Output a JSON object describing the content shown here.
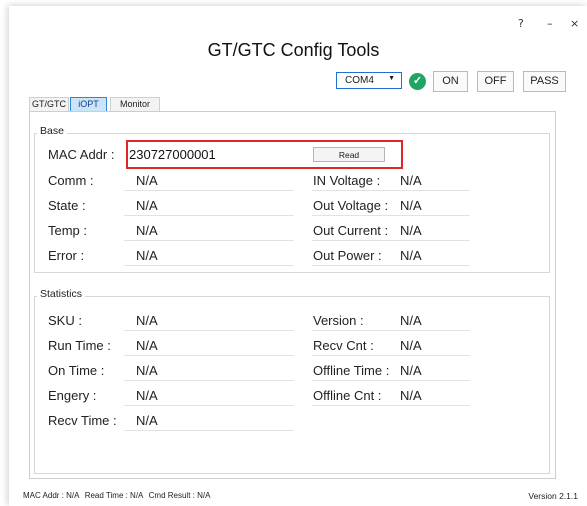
{
  "window": {
    "title": "GT/GTC Config Tools",
    "help_label": "?",
    "minimize_label": "–",
    "close_label": "×"
  },
  "toolbar": {
    "port_value": "COM4",
    "port_caret": "▼",
    "status_icon": "check-circle-icon",
    "status_glyph": "✓",
    "status_color": "#1fa664",
    "on_label": "ON",
    "off_label": "OFF",
    "pass_label": "PASS"
  },
  "tabs": [
    {
      "label": "GT/GTC",
      "active": false
    },
    {
      "label": "iOPT",
      "active": true
    },
    {
      "label": "Monitor",
      "active": false
    }
  ],
  "base": {
    "title": "Base",
    "mac_label": "MAC Addr :",
    "mac_value": "230727000001",
    "read_label": "Read",
    "highlight_color": "#e0262a",
    "left": [
      {
        "label": "Comm :",
        "value": "N/A"
      },
      {
        "label": "State :",
        "value": "N/A"
      },
      {
        "label": "Temp :",
        "value": "N/A"
      },
      {
        "label": "Error :",
        "value": "N/A"
      }
    ],
    "right": [
      {
        "label": "IN Voltage :",
        "value": "N/A"
      },
      {
        "label": "Out Voltage :",
        "value": "N/A"
      },
      {
        "label": "Out Current :",
        "value": "N/A"
      },
      {
        "label": "Out Power :",
        "value": "N/A"
      }
    ]
  },
  "statistics": {
    "title": "Statistics",
    "left": [
      {
        "label": "SKU :",
        "value": "N/A"
      },
      {
        "label": "Run Time :",
        "value": "N/A"
      },
      {
        "label": "On Time :",
        "value": "N/A"
      },
      {
        "label": "Engery :",
        "value": "N/A"
      },
      {
        "label": "Recv Time :",
        "value": "N/A"
      }
    ],
    "right": [
      {
        "label": "Version :",
        "value": "N/A"
      },
      {
        "label": "Recv Cnt :",
        "value": "N/A"
      },
      {
        "label": "Offline Time :",
        "value": "N/A"
      },
      {
        "label": "Offline Cnt :",
        "value": "N/A"
      }
    ]
  },
  "status_bar": {
    "mac": "MAC Addr : N/A",
    "read_time": "Read Time : N/A",
    "cmd_result": "Cmd Result : N/A",
    "version": "Version  2.1.1"
  }
}
